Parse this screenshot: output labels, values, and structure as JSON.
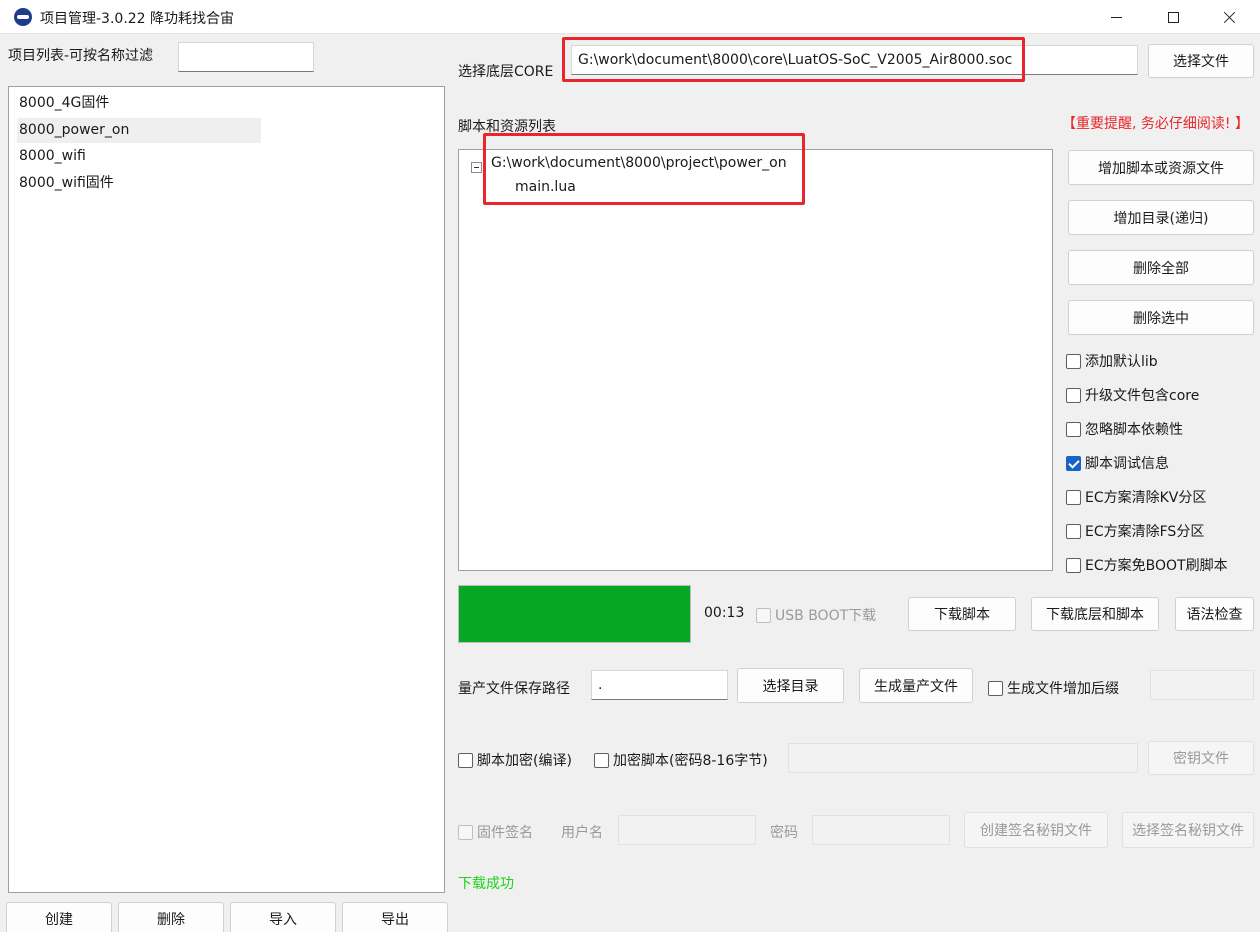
{
  "window": {
    "title": "项目管理-3.0.22 降功耗找合宙",
    "app_icon": "luatools-icon"
  },
  "left_panel": {
    "filter_label": "项目列表-可按名称过滤",
    "filter_value": "",
    "projects": [
      {
        "name": "8000_4G固件",
        "selected": false
      },
      {
        "name": "8000_power_on",
        "selected": true
      },
      {
        "name": "8000_wifi",
        "selected": false
      },
      {
        "name": "8000_wifi固件",
        "selected": false
      }
    ],
    "buttons": {
      "create": "创建",
      "delete": "删除",
      "import": "导入",
      "export": "导出"
    }
  },
  "core": {
    "label": "选择底层CORE",
    "path": "G:\\work\\document\\8000\\core\\LuatOS-SoC_V2005_Air8000.soc",
    "choose_button": "选择文件"
  },
  "scripts": {
    "label": "脚本和资源列表",
    "warning": "【重要提醒, 务必仔细阅读! 】",
    "tree": {
      "folder": "G:\\work\\document\\8000\\project\\power_on",
      "files": [
        "main.lua"
      ]
    },
    "buttons": {
      "add_file": "增加脚本或资源文件",
      "add_dir": "增加目录(递归)",
      "delete_all": "删除全部",
      "delete_selected": "删除选中"
    },
    "options": [
      {
        "label": "添加默认lib",
        "checked": false
      },
      {
        "label": "升级文件包含core",
        "checked": false
      },
      {
        "label": "忽略脚本依赖性",
        "checked": false
      },
      {
        "label": "脚本调试信息",
        "checked": true
      },
      {
        "label": "EC方案清除KV分区",
        "checked": false
      },
      {
        "label": "EC方案清除FS分区",
        "checked": false
      },
      {
        "label": "EC方案免BOOT刷脚本",
        "checked": false
      }
    ]
  },
  "download": {
    "progress": 1.0,
    "progress_color": "#06a823",
    "elapsed": "00:13",
    "usb_boot_label": "USB BOOT下载",
    "usb_boot_checked": false,
    "download_script": "下载脚本",
    "download_core_script": "下载底层和脚本",
    "syntax_check": "语法检查"
  },
  "mass_production": {
    "path_label": "量产文件保存路径",
    "path_value": ".",
    "choose_dir": "选择目录",
    "generate": "生成量产文件",
    "suffix_label": "生成文件增加后缀",
    "suffix_checked": false,
    "suffix_value": ""
  },
  "encryption": {
    "compile_label": "脚本加密(编译)",
    "compile_checked": false,
    "encrypt_label": "加密脚本(密码8-16字节)",
    "encrypt_checked": false,
    "password_value": "",
    "key_file": "密钥文件"
  },
  "signing": {
    "label": "固件签名",
    "checked": false,
    "user_label": "用户名",
    "user_value": "",
    "pass_label": "密码",
    "pass_value": "",
    "create_key": "创建签名秘钥文件",
    "select_key": "选择签名秘钥文件"
  },
  "status": {
    "message": "下载成功",
    "color": "#19d419"
  },
  "colors": {
    "highlight": "#e8262b",
    "warning": "#e8262b",
    "checkbox_accent": "#1863c7"
  }
}
